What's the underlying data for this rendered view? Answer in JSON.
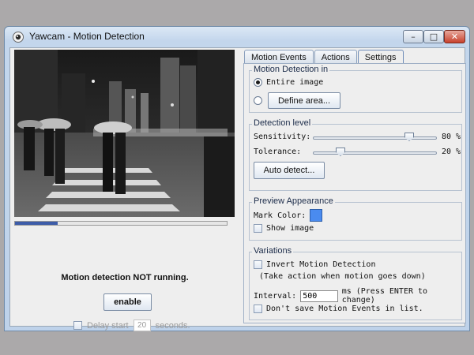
{
  "window": {
    "title": "Yawcam - Motion Detection",
    "controls": {
      "minimize": "–",
      "maximize": "□",
      "close": "✕"
    }
  },
  "icons": {
    "app": "webcam-icon",
    "radio_selected": "radio-selected",
    "radio_unselected": "radio-unselected",
    "checkbox": "checkbox-unchecked"
  },
  "left": {
    "progress_fraction": 0.2,
    "status_text": "Motion detection NOT running.",
    "enable_button": "enable",
    "delay": {
      "label": "Delay start",
      "value": "20",
      "suffix": "seconds.",
      "enabled": false,
      "checked": false
    }
  },
  "tabs": [
    {
      "label": "Motion Events",
      "active": false
    },
    {
      "label": "Actions",
      "active": false
    },
    {
      "label": "Settings",
      "active": true
    }
  ],
  "settings": {
    "detection_in": {
      "title": "Motion Detection in",
      "option_entire": "Entire image",
      "option_area_button": "Define area...",
      "selected": "entire"
    },
    "detection_level": {
      "title": "Detection level",
      "sensitivity_label": "Sensitivity:",
      "sensitivity_value": 80,
      "sensitivity_text": "80 %",
      "tolerance_label": "Tolerance:",
      "tolerance_value": 20,
      "tolerance_text": "20 %",
      "auto_detect_button": "Auto detect..."
    },
    "preview_appearance": {
      "title": "Preview Appearance",
      "mark_color_label": "Mark Color:",
      "mark_color": "#4a8bef",
      "show_image_label": "Show image",
      "show_image_checked": false
    },
    "variations": {
      "title": "Variations",
      "invert_label": "Invert Motion Detection",
      "invert_note": "(Take action when motion goes down)",
      "interval_label": "Interval:",
      "interval_value": "500",
      "interval_suffix": "ms (Press ENTER to change)",
      "dont_save_label": "Don't save Motion Events in list."
    }
  },
  "colors": {
    "accent": "#3d5ca8",
    "mark_color": "#4a8bef",
    "title_bar": "#c3d6ec"
  }
}
